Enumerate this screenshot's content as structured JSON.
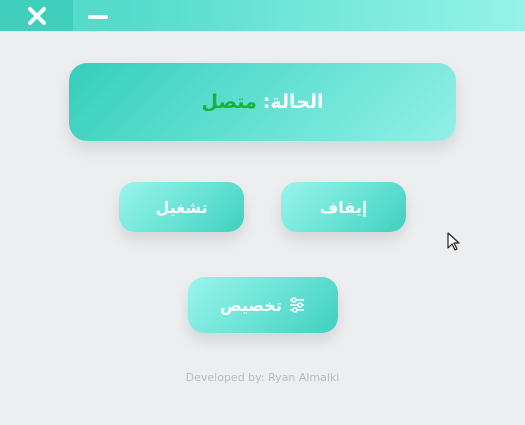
{
  "window": {
    "close_icon": "close-icon",
    "minimize_icon": "minimize-icon"
  },
  "status": {
    "label": "الحالة:",
    "value": "متصل",
    "value_color": "#18b23a"
  },
  "buttons": {
    "stop_label": "إيقاف",
    "run_label": "تشغيل",
    "customize_label": "تخصيص",
    "customize_icon": "sliders-icon"
  },
  "footer": {
    "credit": "Developed by: Ryan Almalki"
  },
  "colors": {
    "accent": "#3fd3c0",
    "accent_light": "#95f3e8",
    "background": "#eceeef"
  }
}
